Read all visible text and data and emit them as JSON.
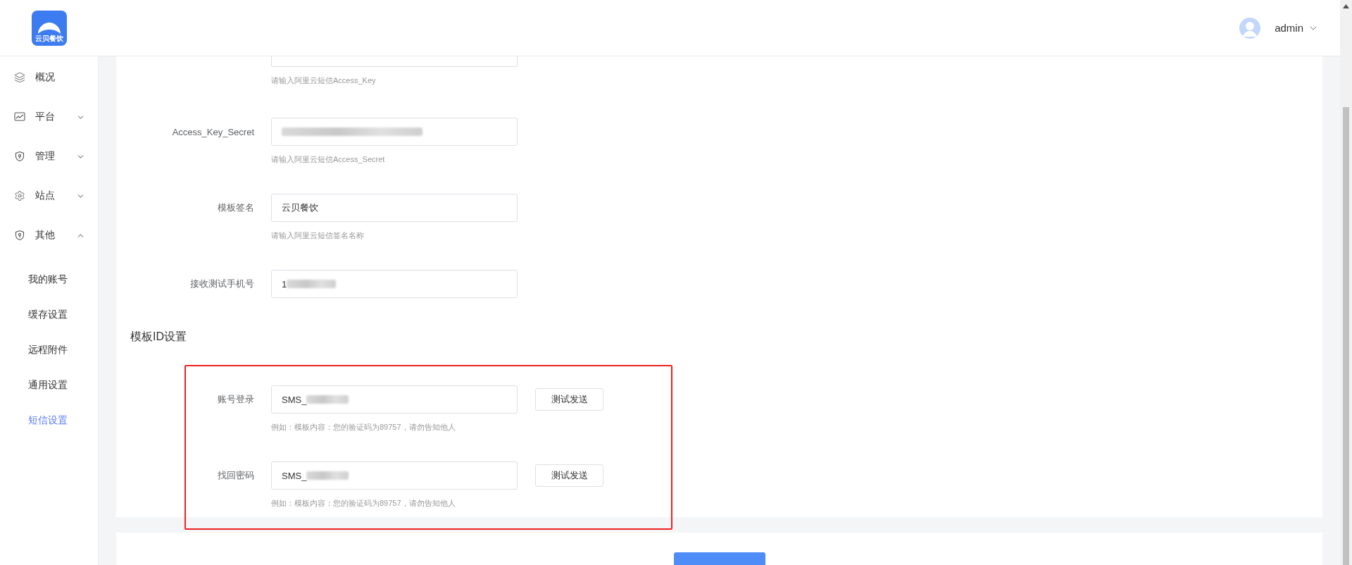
{
  "header": {
    "logo_text": "云贝餐饮",
    "user": "admin"
  },
  "sidebar": {
    "items": [
      {
        "label": "概况"
      },
      {
        "label": "平台",
        "expanded": false
      },
      {
        "label": "管理",
        "expanded": false
      },
      {
        "label": "站点",
        "expanded": false
      },
      {
        "label": "其他",
        "expanded": true,
        "children": [
          {
            "label": "我的账号",
            "selected": false
          },
          {
            "label": "缓存设置",
            "selected": false
          },
          {
            "label": "远程附件",
            "selected": false
          },
          {
            "label": "通用设置",
            "selected": false
          },
          {
            "label": "短信设置",
            "selected": true
          }
        ]
      }
    ]
  },
  "form": {
    "fields": [
      {
        "kind": "partial",
        "hint": "请输入阿里云短信Access_Key"
      },
      {
        "kind": "field",
        "label": "Access_Key_Secret",
        "redacted": true,
        "hint": "请输入阿里云短信Access_Secret"
      },
      {
        "kind": "field",
        "label": "模板签名",
        "value": "云贝餐饮",
        "redacted": false,
        "hint": "请输入阿里云短信签名名称"
      },
      {
        "kind": "field",
        "label": "接收测试手机号",
        "value": "1",
        "redacted": true
      }
    ],
    "section_title": "模板ID设置",
    "template_fields": [
      {
        "label": "账号登录",
        "value": "SMS_",
        "redacted": true,
        "button": "测试发送",
        "hint": "例如：模板内容：您的验证码为89757，请勿告知他人"
      },
      {
        "label": "找回密码",
        "value": "SMS_",
        "redacted": true,
        "button": "测试发送",
        "hint": "例如：模板内容：您的验证码为89757，请勿告知他人"
      }
    ]
  }
}
